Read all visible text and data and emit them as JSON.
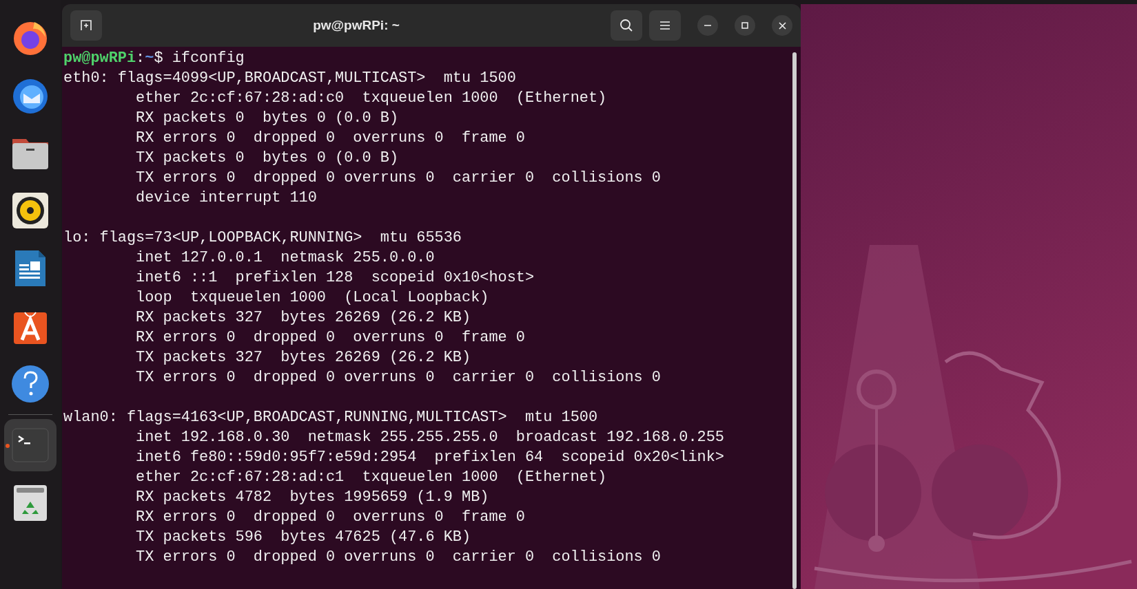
{
  "dock": [
    {
      "kind": "browser",
      "selected": false,
      "running": false
    },
    {
      "kind": "mail",
      "selected": false,
      "running": false
    },
    {
      "kind": "files",
      "selected": false,
      "running": false
    },
    {
      "kind": "music",
      "selected": false,
      "running": false
    },
    {
      "kind": "document",
      "selected": false,
      "running": false
    },
    {
      "kind": "store",
      "selected": false,
      "running": false
    },
    {
      "kind": "help",
      "selected": false,
      "running": false
    },
    {
      "kind": "terminal",
      "selected": true,
      "running": true
    },
    {
      "kind": "trash",
      "selected": false,
      "running": false
    }
  ],
  "window": {
    "title": "pw@pwRPi: ~"
  },
  "terminal": {
    "prompt": {
      "user_host": "pw@pwRPi",
      "separator": ":",
      "path": "~",
      "symbol": "$",
      "command": "ifconfig"
    },
    "blocks": [
      [
        "eth0: flags=4099<UP,BROADCAST,MULTICAST>  mtu 1500",
        "        ether 2c:cf:67:28:ad:c0  txqueuelen 1000  (Ethernet)",
        "        RX packets 0  bytes 0 (0.0 B)",
        "        RX errors 0  dropped 0  overruns 0  frame 0",
        "        TX packets 0  bytes 0 (0.0 B)",
        "        TX errors 0  dropped 0 overruns 0  carrier 0  collisions 0",
        "        device interrupt 110"
      ],
      [
        "lo: flags=73<UP,LOOPBACK,RUNNING>  mtu 65536",
        "        inet 127.0.0.1  netmask 255.0.0.0",
        "        inet6 ::1  prefixlen 128  scopeid 0x10<host>",
        "        loop  txqueuelen 1000  (Local Loopback)",
        "        RX packets 327  bytes 26269 (26.2 KB)",
        "        RX errors 0  dropped 0  overruns 0  frame 0",
        "        TX packets 327  bytes 26269 (26.2 KB)",
        "        TX errors 0  dropped 0 overruns 0  carrier 0  collisions 0"
      ],
      [
        "wlan0: flags=4163<UP,BROADCAST,RUNNING,MULTICAST>  mtu 1500",
        "        inet 192.168.0.30  netmask 255.255.255.0  broadcast 192.168.0.255",
        "        inet6 fe80::59d0:95f7:e59d:2954  prefixlen 64  scopeid 0x20<link>",
        "        ether 2c:cf:67:28:ad:c1  txqueuelen 1000  (Ethernet)",
        "        RX packets 4782  bytes 1995659 (1.9 MB)",
        "        RX errors 0  dropped 0  overruns 0  frame 0",
        "        TX packets 596  bytes 47625 (47.6 KB)",
        "        TX errors 0  dropped 0 overruns 0  carrier 0  collisions 0"
      ]
    ]
  }
}
